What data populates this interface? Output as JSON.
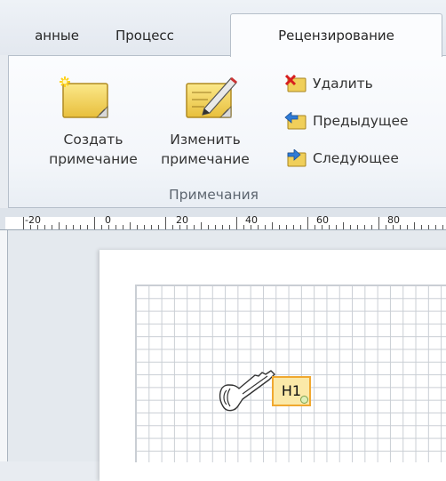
{
  "tabs": {
    "data": "анные",
    "process": "Процесс",
    "review": "Рецензирование"
  },
  "ribbon": {
    "create_comment": {
      "line1": "Создать",
      "line2": "примечание",
      "icon": "new-comment-icon"
    },
    "edit_comment": {
      "line1": "Изменить",
      "line2": "примечание",
      "icon": "edit-comment-icon"
    },
    "delete": {
      "label": "Удалить",
      "icon": "delete-comment-icon"
    },
    "previous": {
      "label": "Предыдущее",
      "icon": "previous-comment-icon"
    },
    "next": {
      "label": "Следующее",
      "icon": "next-comment-icon"
    },
    "group_label": "Примечания"
  },
  "ruler": {
    "labels": [
      "-20",
      "0",
      "20",
      "40",
      "60",
      "80"
    ]
  },
  "canvas": {
    "comment_marker": "H1",
    "shape_icon": "key-icon"
  },
  "colors": {
    "accent": "#f0a830",
    "note_fill": "#f5d96b"
  }
}
